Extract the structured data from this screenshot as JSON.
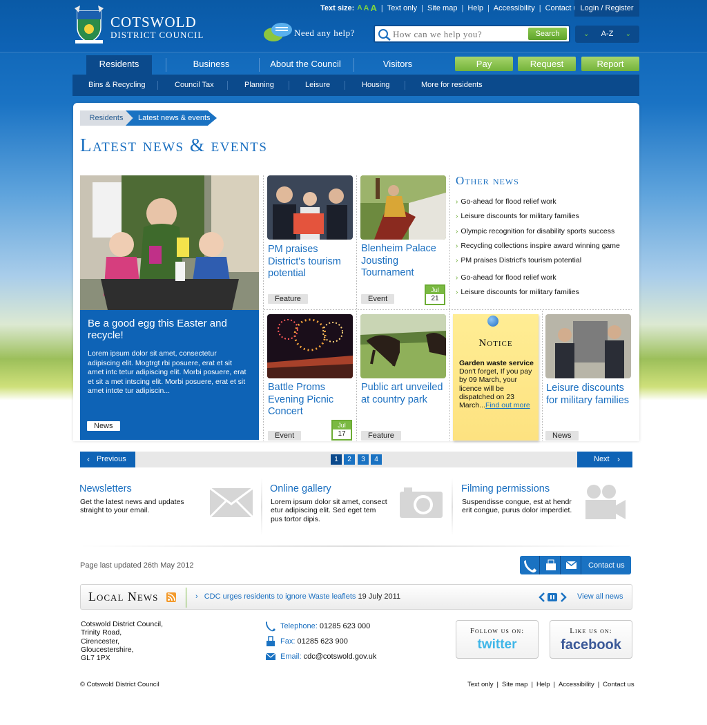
{
  "header": {
    "brand_line1": "COTSWOLD",
    "brand_line2": "DISTRICT COUNCIL",
    "text_size_label": "Text size:",
    "text_size_options": [
      "A",
      "A",
      "A"
    ],
    "top_links": [
      "Text only",
      "Site map",
      "Help",
      "Accessibility",
      "Contact us"
    ],
    "login_label": "Login / Register",
    "help_label": "Need any help?",
    "search_placeholder": "How can we help you?",
    "search_button": "Search",
    "az_label": "A-Z"
  },
  "nav": {
    "tabs": [
      "Residents",
      "Business",
      "About the Council",
      "Visitors"
    ],
    "active_tab": "Residents",
    "action_buttons": [
      "Pay",
      "Request",
      "Report"
    ],
    "sub_items": [
      "Bins & Recycling",
      "Council Tax",
      "Planning",
      "Leisure",
      "Housing",
      "More for residents"
    ]
  },
  "breadcrumb": [
    "Residents",
    "Latest news & events"
  ],
  "page_title": "Latest news & events",
  "featured": {
    "title": "Be a good egg this Easter and recycle!",
    "text": "Lorem ipsum dolor sit amet, consectetur adipiscing elit. Mogtrgt rbi posuere, erat et  sit amet intc tetur adipiscing elit. Morbi posuere, erat et  sit a met intscing elit. Morbi posuere, erat et  sit amet intcte tur adipiscin...",
    "tag": "News"
  },
  "tiles": [
    {
      "title": "PM praises District's tourism potential",
      "tag": "Feature"
    },
    {
      "title": "Blenheim Palace Jousting Tournament",
      "tag": "Event",
      "cal_month": "Jul",
      "cal_day": "21"
    },
    {
      "title": "Battle Proms Evening Picnic Concert",
      "tag": "Event",
      "cal_month": "Jul",
      "cal_day": "17"
    },
    {
      "title": "Public art unveiled at country park",
      "tag": "Feature"
    },
    {
      "title": "Leisure discounts for military families",
      "tag": "News"
    }
  ],
  "other_news": {
    "heading": "Other news",
    "items": [
      "Go-ahead for flood relief work",
      "Leisure discounts for military families",
      "Olympic recognition for disability sports success",
      "Recycling collections inspire award winning game",
      "PM praises District's tourism potential",
      "Go-ahead for flood relief work",
      "Leisure discounts for military families"
    ]
  },
  "notice": {
    "heading": "Notice",
    "bold": "Garden waste service",
    "text": "Don't forget, If you pay by 09 March, your licence will be dispatched on 23 March...",
    "link": "Find out more"
  },
  "pager": {
    "prev": "Previous",
    "next": "Next",
    "pages": [
      "1",
      "2",
      "3",
      "4"
    ],
    "current": "1"
  },
  "promos": [
    {
      "title": "Newsletters",
      "text": "Get the latest news and updates straight to your email.",
      "icon": "envelope-icon"
    },
    {
      "title": "Online gallery",
      "text": "Lorem ipsum dolor sit amet, consect etur adipiscing elit. Sed eget tem pus tortor dipis.",
      "icon": "camera-icon"
    },
    {
      "title": "Filming permissions",
      "text": "Suspendisse congue, est at hendr erit congue, purus dolor imperdiet.",
      "icon": "video-camera-icon"
    }
  ],
  "last_updated": "Page last updated 26th May 2012",
  "contact_bar_label": "Contact us",
  "local_news": {
    "heading": "Local News",
    "item_link": "CDC urges residents to ignore Waste leaflets",
    "item_date": "19 July 2011",
    "view_all": "View all news"
  },
  "address_lines": [
    "Cotswold District Council,",
    "Trinity Road,",
    "Cirencester,",
    "Gloucestershire,",
    "GL7 1PX"
  ],
  "contacts": [
    {
      "label": "Telephone:",
      "value": "01285 623 000"
    },
    {
      "label": "Fax:",
      "value": "01285 623 900"
    },
    {
      "label": "Email:",
      "value": "cdc@cotswold.gov.uk"
    }
  ],
  "social": [
    {
      "heading": "Follow us on:",
      "logo": "twitter"
    },
    {
      "heading": "Like us on:",
      "logo": "facebook"
    }
  ],
  "footer": {
    "copyright": "© Cotswold District Council",
    "links": [
      "Text only",
      "Site map",
      "Help",
      "Accessibility",
      "Contact us"
    ]
  },
  "colors": {
    "primary_blue": "#0e63b6",
    "dark_blue": "#0b4a8c",
    "accent_green": "#7ab942",
    "link_blue": "#1a6fc0"
  }
}
